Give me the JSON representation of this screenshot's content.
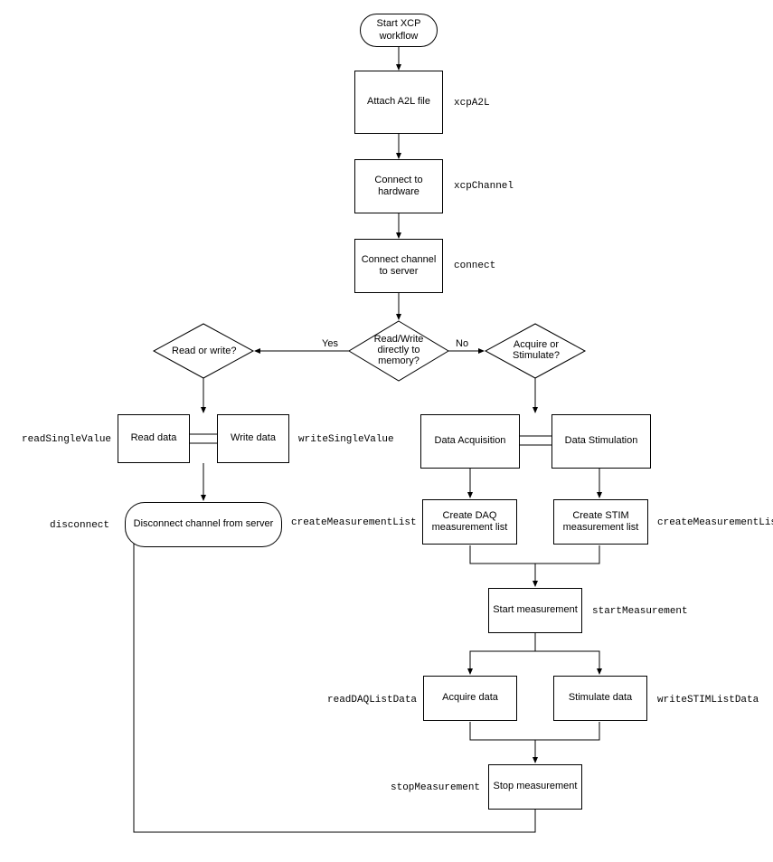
{
  "nodes": {
    "start": "Start XCP workflow",
    "attach": "Attach A2L file",
    "connectHw": "Connect to hardware",
    "connectChan": "Connect channel to server",
    "rwMem": "Read/Write directly to memory?",
    "readOrWrite": "Read or write?",
    "acqOrStim": "Acquire or Stimulate?",
    "readData": "Read data",
    "writeData": "Write data",
    "dataAcq": "Data Acquisition",
    "dataStim": "Data Stimulation",
    "createDaq": "Create DAQ measurement list",
    "createStim": "Create STIM measurement list",
    "startMeas": "Start measurement",
    "acquire": "Acquire data",
    "stimulate": "Stimulate data",
    "stopMeas": "Stop measurement",
    "disconnect": "Disconnect channel from server"
  },
  "labels": {
    "xcpA2L": "xcpA2L",
    "xcpChannel": "xcpChannel",
    "connect": "connect",
    "readSingle": "readSingleValue",
    "writeSingle": "writeSingleValue",
    "disconnect": "disconnect",
    "createMeasL": "createMeasurementList",
    "createMeasR": "createMeasurementList",
    "startMeas": "startMeasurement",
    "readDAQ": "readDAQListData",
    "writeSTIM": "writeSTIMListData",
    "stopMeas": "stopMeasurement"
  },
  "edges": {
    "yes": "Yes",
    "no": "No"
  }
}
